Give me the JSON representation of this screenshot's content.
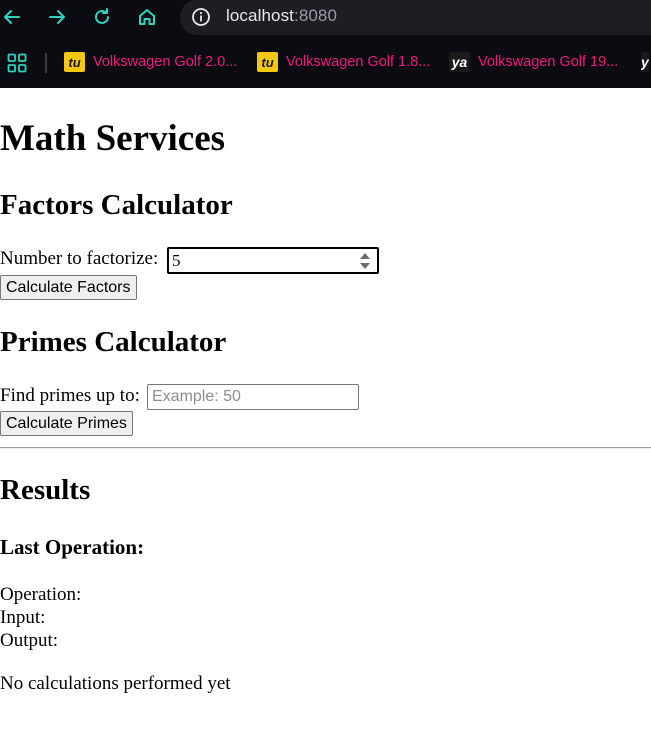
{
  "browser": {
    "url_host": "localhost",
    "url_port": ":8080",
    "bookmarks": [
      {
        "label": "Volkswagen Golf 2.0...",
        "favicon": "tu"
      },
      {
        "label": "Volkswagen Golf 1.8...",
        "favicon": "tu"
      },
      {
        "label": "Volkswagen Golf 19...",
        "favicon": "ya"
      }
    ],
    "colors": {
      "chrome_bg": "#0b0b12",
      "nav_icon": "#2dd4bf",
      "bookmark_text": "#f0197d"
    }
  },
  "page": {
    "title": "Math Services",
    "factors": {
      "heading": "Factors Calculator",
      "label": "Number to factorize:",
      "value": "5",
      "button": "Calculate Factors"
    },
    "primes": {
      "heading": "Primes Calculator",
      "label": "Find primes up to:",
      "placeholder": "Example: 50",
      "button": "Calculate Primes"
    },
    "results": {
      "heading": "Results",
      "last_op_heading": "Last Operation:",
      "operation_label": "Operation:",
      "input_label": "Input:",
      "output_label": "Output:",
      "empty_message": "No calculations performed yet"
    }
  }
}
